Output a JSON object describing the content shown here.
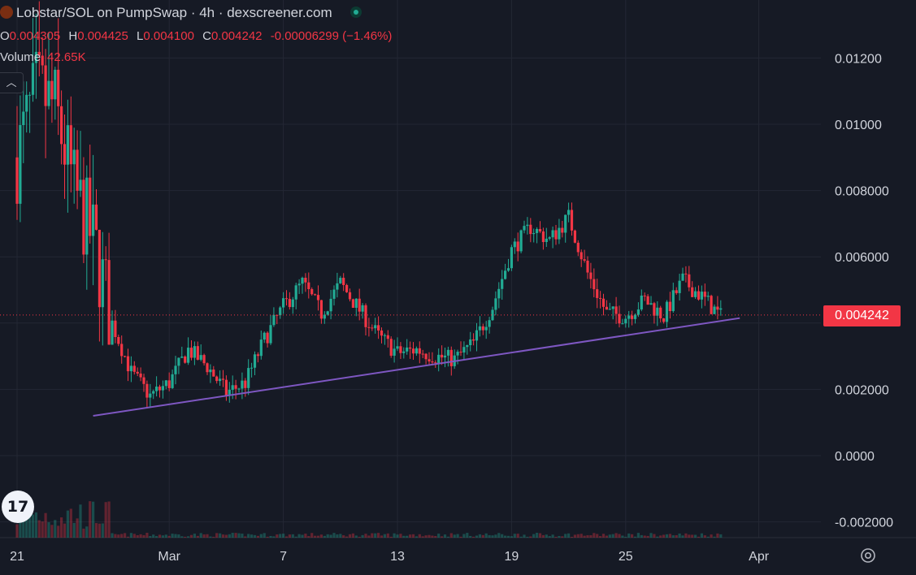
{
  "header": {
    "title": "Lobstar/SOL on PumpSwap · 4h · dexscreener.com",
    "ohlc": [
      {
        "key": "O",
        "value": "0.004305"
      },
      {
        "key": "H",
        "value": "0.004425"
      },
      {
        "key": "L",
        "value": "0.004100"
      },
      {
        "key": "C",
        "value": "0.004242"
      }
    ],
    "change": "-0.00006299 (−1.46%)",
    "volume_label": "Volume",
    "volume_value": "42.65K"
  },
  "price_badge": "0.004242",
  "tv_logo": "17",
  "colors": {
    "up": "#22ab94",
    "down": "#f23645",
    "trendline": "#7e57c2",
    "background": "#161a25"
  },
  "icons": [
    "chevron-up-icon",
    "gear-icon",
    "tradingview-logo-icon"
  ],
  "chart_data": {
    "type": "candlestick",
    "timeframe": "4h",
    "x_tick_labels": [
      "21",
      "Mar",
      "7",
      "13",
      "19",
      "25",
      "Apr"
    ],
    "y_tick_labels": [
      "0.01200",
      "0.01000",
      "0.008000",
      "0.006000",
      "0.002000",
      "0.0000",
      "-0.002000"
    ],
    "y_ticks": [
      0.012,
      0.01,
      0.008,
      0.006,
      0.002,
      0,
      -0.002
    ],
    "ylim": [
      -0.0023,
      0.0133
    ],
    "last_price": 0.004242,
    "trendline": {
      "start": [
        "Feb 25",
        0.0012
      ],
      "end": [
        "Mar 31",
        0.00415
      ]
    },
    "approx_close_path": [
      [
        "Feb 21",
        0.009
      ],
      [
        "Feb 22",
        0.011
      ],
      [
        "Feb 23",
        0.0105
      ],
      [
        "Feb 24",
        0.008
      ],
      [
        "Feb 25",
        0.0065
      ],
      [
        "Feb 26",
        0.004
      ],
      [
        "Feb 27",
        0.0025
      ],
      [
        "Feb 28",
        0.0018
      ],
      [
        "Mar 1",
        0.0022
      ],
      [
        "Mar 2",
        0.0032
      ],
      [
        "Mar 3",
        0.0027
      ],
      [
        "Mar 4",
        0.0019
      ],
      [
        "Mar 5",
        0.0022
      ],
      [
        "Mar 6",
        0.0035
      ],
      [
        "Mar 7",
        0.0045
      ],
      [
        "Mar 8",
        0.0052
      ],
      [
        "Mar 9",
        0.0043
      ],
      [
        "Mar 10",
        0.0052
      ],
      [
        "Mar 11",
        0.0044
      ],
      [
        "Mar 12",
        0.0036
      ],
      [
        "Mar 13",
        0.0031
      ],
      [
        "Mar 14",
        0.0032
      ],
      [
        "Mar 15",
        0.003
      ],
      [
        "Mar 16",
        0.0029
      ],
      [
        "Mar 17",
        0.0034
      ],
      [
        "Mar 18",
        0.0045
      ],
      [
        "Mar 19",
        0.0062
      ],
      [
        "Mar 20",
        0.0069
      ],
      [
        "Mar 21",
        0.0065
      ],
      [
        "Mar 22",
        0.0072
      ],
      [
        "Mar 23",
        0.0055
      ],
      [
        "Mar 24",
        0.0043
      ],
      [
        "Mar 25",
        0.0042
      ],
      [
        "Mar 26",
        0.0047
      ],
      [
        "Mar 27",
        0.0042
      ],
      [
        "Mar 28",
        0.0053
      ],
      [
        "Mar 29",
        0.0048
      ],
      [
        "Mar 30",
        0.0042
      ]
    ],
    "grid": true
  }
}
